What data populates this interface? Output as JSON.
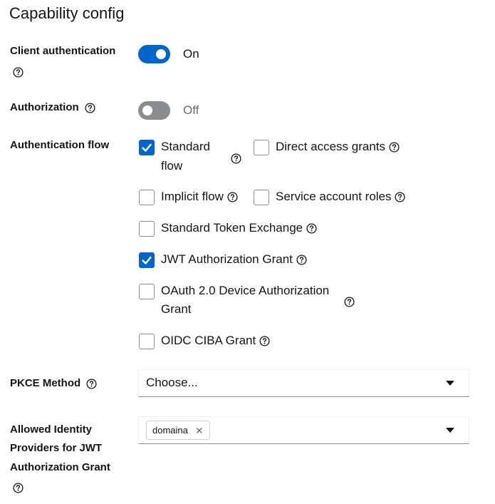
{
  "page": {
    "title": "Capability config"
  },
  "fields": {
    "client_auth": {
      "label": "Client authentication",
      "state": "On"
    },
    "authorization": {
      "label": "Authorization",
      "state": "Off"
    },
    "auth_flow": {
      "label": "Authentication flow",
      "options": {
        "standard_line1": "Standard",
        "standard_line2": "flow",
        "direct_access": "Direct access grants",
        "implicit": "Implicit flow",
        "service_account": "Service account roles",
        "token_exchange": "Standard Token Exchange",
        "jwt_grant": "JWT Authorization Grant",
        "device_line1": "OAuth 2.0 Device Authorization",
        "device_line2": "Grant",
        "ciba": "OIDC CIBA Grant"
      }
    },
    "pkce": {
      "label": "PKCE Method",
      "placeholder": "Choose..."
    },
    "allowed_idp": {
      "label_line1": "Allowed Identity",
      "label_line2": "Providers for JWT",
      "label_line3": "Authorization Grant",
      "chip": "domaina",
      "chip_remove": "✕"
    }
  },
  "colors": {
    "primary": "#0066cc",
    "off_switch": "#8a8d90",
    "text": "#151515",
    "muted": "#6a6e73"
  }
}
